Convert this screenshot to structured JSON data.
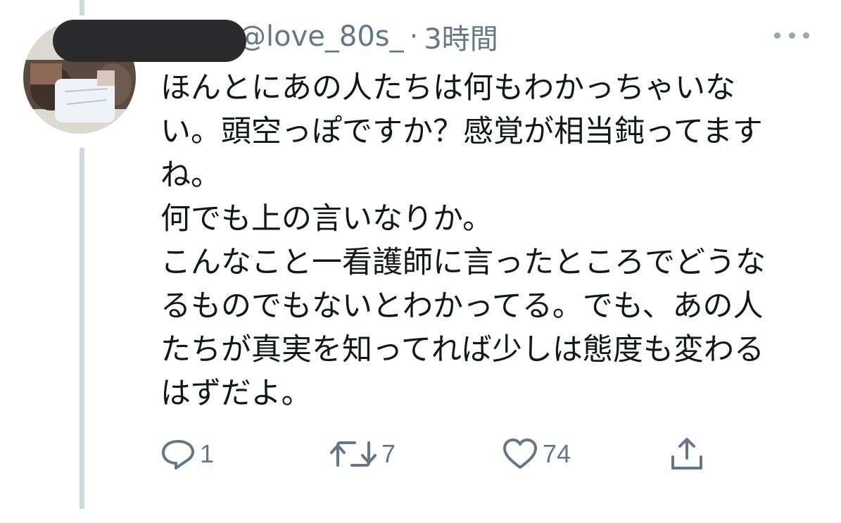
{
  "tweet": {
    "display_name": "",
    "handle": "@love_80s_",
    "separator": "·",
    "time": "3時間",
    "text": "ほんとにあの人たちは何もわかっちゃいな\nい。頭空っぽですか？感覚が相当鈍ってます\nね。\n何でも上の言いなりか。\nこんなこと一看護師に言ったところでどうな\nるものでもないとわかってる。でも、あの人\nたちが真実を知ってれば少しは態度も変わる\nはずだよ。",
    "actions": {
      "reply": {
        "icon": "reply-icon",
        "count": "1"
      },
      "retweet": {
        "icon": "retweet-icon",
        "count": "7"
      },
      "like": {
        "icon": "heart-icon",
        "count": "74"
      },
      "share": {
        "icon": "share-icon"
      }
    }
  },
  "colors": {
    "text": "#14171a",
    "secondary": "#657786",
    "thread_line": "#cfd9de",
    "redaction": "#2b2b2d"
  }
}
